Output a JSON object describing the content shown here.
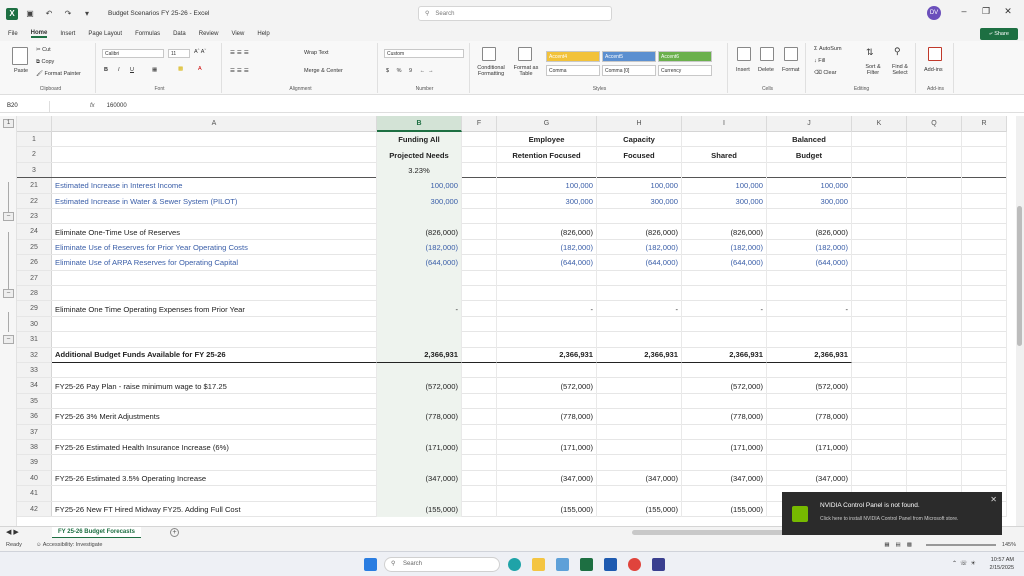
{
  "window": {
    "title": "Budget Scenarios FY 25-26  -  Excel",
    "search_placeholder": "Search",
    "avatar_initials": "DV",
    "autosave_icon": "save-icon"
  },
  "ribbon_tabs": [
    "File",
    "Home",
    "Insert",
    "Page Layout",
    "Formulas",
    "Data",
    "Review",
    "View",
    "Help"
  ],
  "share_label": "Share",
  "ribbon": {
    "clipboard": {
      "paste": "Paste",
      "cut": "Cut",
      "copy": "Copy",
      "format_painter": "Format Painter",
      "label": "Clipboard"
    },
    "font": {
      "name": "Calibri",
      "size": "11",
      "label": "Font"
    },
    "alignment": {
      "wrap": "Wrap Text",
      "merge": "Merge & Center",
      "label": "Alignment"
    },
    "number": {
      "format": "Custom",
      "label": "Number"
    },
    "styles": {
      "conditional": "Conditional Formatting",
      "format_table": "Format as Table",
      "chips": [
        "Accent4",
        "Accent5",
        "Accent6",
        "Comma",
        "Comma [0]",
        "Currency"
      ],
      "label": "Styles"
    },
    "cells": {
      "insert": "Insert",
      "delete": "Delete",
      "format": "Format",
      "label": "Cells"
    },
    "editing": {
      "autosum": "AutoSum",
      "fill": "Fill",
      "clear": "Clear",
      "sort": "Sort & Filter",
      "find": "Find & Select",
      "label": "Editing"
    },
    "addins": {
      "addins": "Add-ins",
      "label": "Add-ins"
    }
  },
  "formula_bar": {
    "name_box": "B20",
    "fx": "fx",
    "value": "160000"
  },
  "columns": [
    "A",
    "B",
    "F",
    "G",
    "H",
    "I",
    "J",
    "K",
    "Q",
    "R"
  ],
  "header_rows": {
    "r1": [
      "",
      "Funding All",
      "",
      "Employee",
      "Capacity",
      "",
      "Balanced"
    ],
    "r2": [
      "",
      "Projected Needs",
      "",
      "Retention Focused",
      "Focused",
      "Shared",
      "Budget"
    ],
    "r3": [
      "",
      "3.23%",
      "",
      "",
      "",
      "",
      ""
    ]
  },
  "rows": [
    {
      "n": "21",
      "label": "Estimated Increase in Interest Income",
      "blue": true,
      "b": "100,000",
      "g": "100,000",
      "h": "100,000",
      "i": "100,000",
      "j": "100,000"
    },
    {
      "n": "22",
      "label": "Estimated Increase in Water & Sewer System (PILOT)",
      "blue": true,
      "b": "300,000",
      "g": "300,000",
      "h": "300,000",
      "i": "300,000",
      "j": "300,000"
    },
    {
      "n": "23",
      "label": "",
      "b": "",
      "g": "",
      "h": "",
      "i": "",
      "j": ""
    },
    {
      "n": "24",
      "label": "Eliminate One-Time Use of Reserves",
      "b": "(826,000)",
      "g": "(826,000)",
      "h": "(826,000)",
      "i": "(826,000)",
      "j": "(826,000)"
    },
    {
      "n": "25",
      "label": "Eliminate Use of Reserves for Prior Year Operating Costs",
      "blue": true,
      "b": "(182,000)",
      "g": "(182,000)",
      "h": "(182,000)",
      "i": "(182,000)",
      "j": "(182,000)"
    },
    {
      "n": "26",
      "label": "Eliminate Use of ARPA Reserves for Operating Capital",
      "blue": true,
      "b": "(644,000)",
      "g": "(644,000)",
      "h": "(644,000)",
      "i": "(644,000)",
      "j": "(644,000)"
    },
    {
      "n": "27",
      "label": "",
      "b": "",
      "g": "",
      "h": "",
      "i": "",
      "j": ""
    },
    {
      "n": "28",
      "label": "",
      "b": "",
      "g": "",
      "h": "",
      "i": "",
      "j": ""
    },
    {
      "n": "29",
      "label": "Eliminate One Time Operating Expenses from Prior Year",
      "b": "-",
      "g": "-",
      "h": "-",
      "i": "-",
      "j": "-"
    },
    {
      "n": "30",
      "label": "",
      "b": "",
      "g": "",
      "h": "",
      "i": "",
      "j": ""
    },
    {
      "n": "31",
      "label": "",
      "b": "",
      "g": "",
      "h": "",
      "i": "",
      "j": ""
    },
    {
      "n": "32",
      "label": "Additional Budget Funds Available for FY 25-26",
      "bold": true,
      "b": "2,366,931",
      "g": "2,366,931",
      "h": "2,366,931",
      "i": "2,366,931",
      "j": "2,366,931"
    },
    {
      "n": "33",
      "label": "",
      "b": "",
      "g": "",
      "h": "",
      "i": "",
      "j": ""
    },
    {
      "n": "34",
      "label": "FY25-26 Pay Plan - raise minimum wage to $17.25",
      "b": "(572,000)",
      "g": "(572,000)",
      "h": "",
      "i": "(572,000)",
      "j": "(572,000)"
    },
    {
      "n": "35",
      "label": "",
      "b": "",
      "g": "",
      "h": "",
      "i": "",
      "j": ""
    },
    {
      "n": "36",
      "label": "FY25-26 3% Merit Adjustments",
      "b": "(778,000)",
      "g": "(778,000)",
      "h": "",
      "i": "(778,000)",
      "j": "(778,000)"
    },
    {
      "n": "37",
      "label": "",
      "b": "",
      "g": "",
      "h": "",
      "i": "",
      "j": ""
    },
    {
      "n": "38",
      "label": "FY25-26 Estimated Health Insurance Increase (6%)",
      "b": "(171,000)",
      "g": "(171,000)",
      "h": "",
      "i": "(171,000)",
      "j": "(171,000)"
    },
    {
      "n": "39",
      "label": "",
      "b": "",
      "g": "",
      "h": "",
      "i": "",
      "j": ""
    },
    {
      "n": "40",
      "label": "FY25-26 Estimated 3.5% Operating Increase",
      "b": "(347,000)",
      "g": "(347,000)",
      "h": "(347,000)",
      "i": "(347,000)",
      "j": "(347,000)"
    },
    {
      "n": "41",
      "label": "",
      "b": "",
      "g": "",
      "h": "",
      "i": "",
      "j": ""
    },
    {
      "n": "42",
      "label": "FY25-26 New FT Hired Midway FY25. Adding Full Cost",
      "b": "(155,000)",
      "g": "(155,000)",
      "h": "(155,000)",
      "i": "(155,000)",
      "j": ""
    }
  ],
  "sheet_tab": "FY 25-26 Budget Forecasts",
  "status": {
    "ready": "Ready",
    "accessibility": "Accessibility: Investigate",
    "zoom": "145%"
  },
  "taskbar": {
    "search": "Search",
    "time": "10:57 AM",
    "date": "2/15/2025"
  },
  "toast": {
    "title": "NVIDIA Control Panel is not found.",
    "body": "Click here to install NVIDIA Control Panel from Microsoft store."
  },
  "colors": {
    "excel_green": "#1d6f42",
    "blue_text": "#3a5ea8"
  }
}
